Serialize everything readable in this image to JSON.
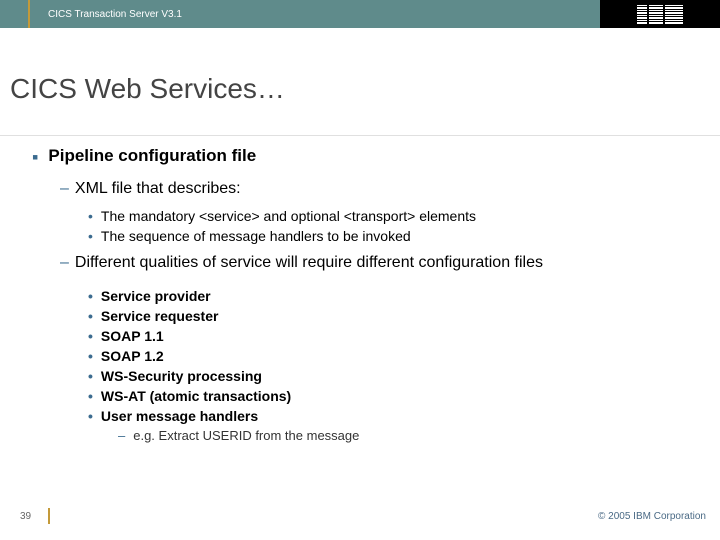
{
  "header": {
    "product": "CICS Transaction Server V3.1",
    "vendor": "IBM"
  },
  "slide": {
    "title": "CICS Web Services…",
    "section_heading": "Pipeline configuration file",
    "sub1_intro": "XML file that describes:",
    "sub1_items": [
      "The mandatory <service> and optional <transport> elements",
      "The sequence of message handlers to be invoked"
    ],
    "sub2_intro": "Different qualities of service will require different configuration files",
    "sub2_items": [
      "Service provider",
      "Service requester",
      "SOAP 1.1",
      "SOAP 1.2",
      "WS-Security processing",
      "WS-AT (atomic transactions)",
      "User message handlers"
    ],
    "sub2_note": "e.g. Extract USERID from the message"
  },
  "footer": {
    "page": "39",
    "copyright": "© 2005 IBM Corporation"
  }
}
